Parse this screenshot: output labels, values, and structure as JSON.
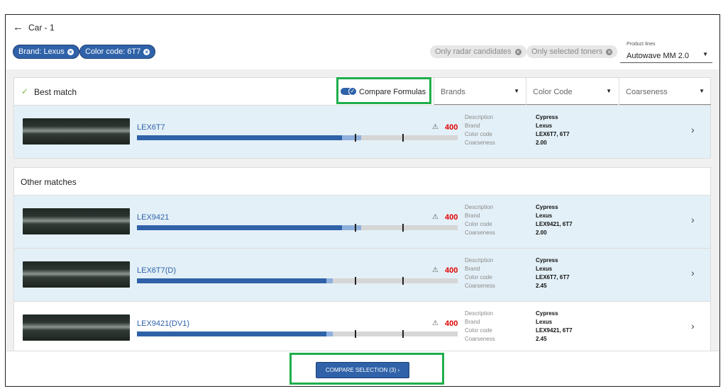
{
  "header": {
    "back_icon": "←",
    "title": "Car - 1"
  },
  "filter_chips": [
    {
      "label": "Brand: Lexus",
      "remove_icon": "×"
    },
    {
      "label": "Color code: 6T7",
      "remove_icon": "×"
    }
  ],
  "toggle_pills": [
    {
      "label": "Only radar candidates",
      "remove_icon": "×"
    },
    {
      "label": "Only selected toners",
      "remove_icon": "×"
    }
  ],
  "product_lines": {
    "caption": "Product lines",
    "value": "Autowave MM 2.0",
    "arrow": "▼"
  },
  "best_match": {
    "check_icon": "✓",
    "title": "Best match",
    "compare_label": "Compare Formulas",
    "compare_checked": true,
    "check_glyph": "✓",
    "dropdowns": [
      {
        "label": "Brands",
        "arrow": "▼"
      },
      {
        "label": "Color Code",
        "arrow": "▼"
      },
      {
        "label": "Coarseness",
        "arrow": "▼"
      }
    ]
  },
  "detail_labels": {
    "description": "Description",
    "brand": "Brand",
    "color_code": "Color code",
    "coarseness": "Coarseness"
  },
  "best_row": {
    "code": "LEX6T7",
    "warn_icon": "⚠",
    "score": "400",
    "fill_fraction": 0.64,
    "light_fraction": 0.06,
    "description": "Cypress",
    "brand": "Lexus",
    "color_code": "LEX6T7, 6T7",
    "coarseness": "2.00",
    "chevron": "›"
  },
  "other_matches": {
    "title": "Other matches",
    "rows": [
      {
        "code": "LEX9421",
        "warn_icon": "⚠",
        "score": "400",
        "fill_fraction": 0.64,
        "light_fraction": 0.06,
        "description": "Cypress",
        "brand": "Lexus",
        "color_code": "LEX9421, 6T7",
        "coarseness": "2.00",
        "chevron": "›"
      },
      {
        "code": "LEX6T7(D)",
        "warn_icon": "⚠",
        "score": "400",
        "fill_fraction": 0.59,
        "light_fraction": 0.02,
        "description": "Cypress",
        "brand": "Lexus",
        "color_code": "LEX6T7, 6T7",
        "coarseness": "2.45",
        "chevron": "›"
      },
      {
        "code": "LEX9421(DV1)",
        "warn_icon": "⚠",
        "score": "400",
        "fill_fraction": 0.59,
        "light_fraction": 0.02,
        "description": "Cypress",
        "brand": "Lexus",
        "color_code": "LEX9421, 6T7",
        "coarseness": "2.45",
        "chevron": "›"
      }
    ]
  },
  "footer": {
    "compare_selection": "COMPARE SELECTION (3) ›"
  },
  "colors": {
    "accent": "#2f62a8",
    "highlight": "#1fae4b",
    "score": "#e00000",
    "row_highlight": "#e3f0f7"
  }
}
